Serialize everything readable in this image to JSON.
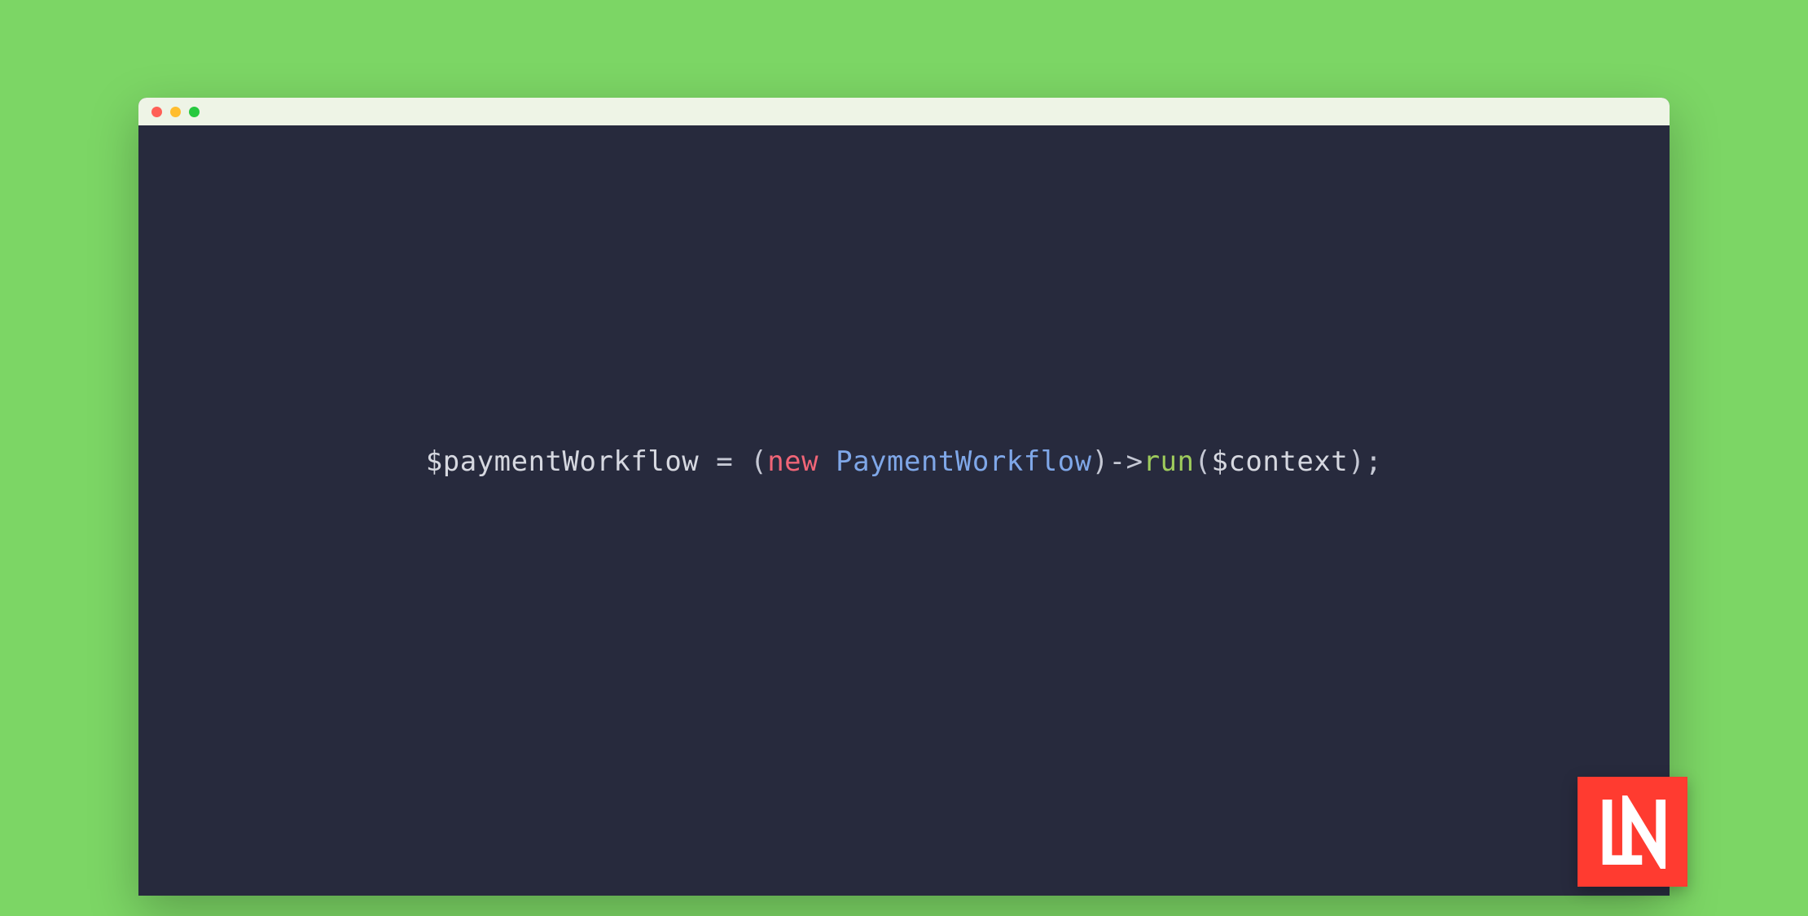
{
  "colors": {
    "background": "#7cd665",
    "editor_bg": "#272a3d",
    "titlebar_bg": "#eef4e6",
    "traffic_red": "#ff5f56",
    "traffic_yellow": "#ffbd2e",
    "traffic_green": "#27c93f",
    "logo_bg": "#ff3b30",
    "keyword": "#f06577",
    "class": "#7fa7e8",
    "method": "#9ecb5c",
    "default": "#c5c8d4"
  },
  "code": {
    "variable1": "$paymentWorkflow",
    "assign": " = ",
    "paren_open1": "(",
    "keyword_new": "new",
    "space": " ",
    "class_name": "PaymentWorkflow",
    "paren_close1": ")",
    "arrow": "->",
    "method": "run",
    "paren_open2": "(",
    "variable2": "$context",
    "paren_close2": ")",
    "semi": ";"
  },
  "logo": {
    "label": "LN"
  }
}
